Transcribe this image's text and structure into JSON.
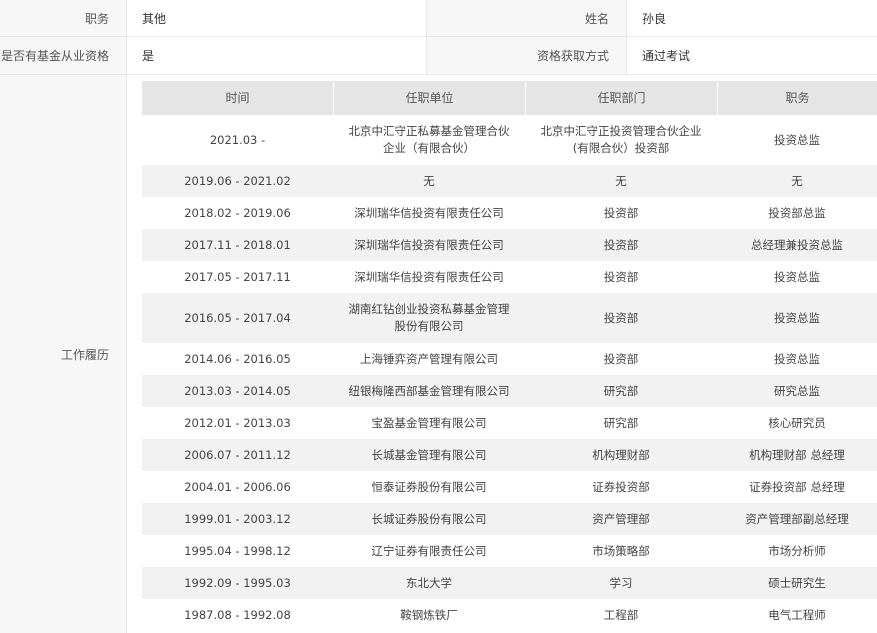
{
  "profile": {
    "position_label": "职务",
    "position_value": "其他",
    "name_label": "姓名",
    "name_value": "孙良",
    "qualification_label": "是否有基金从业资格",
    "qualification_value": "是",
    "method_label": "资格获取方式",
    "method_value": "通过考试",
    "history_label": "工作履历"
  },
  "work_history": {
    "headers": [
      "时间",
      "任职单位",
      "任职部门",
      "职务"
    ],
    "rows": [
      [
        "2021.03 -",
        "北京中汇守正私募基金管理合伙企业（有限合伙）",
        "北京中汇守正投资管理合伙企业(有限合伙）投资部",
        "投资总监"
      ],
      [
        "2019.06 - 2021.02",
        "无",
        "无",
        "无"
      ],
      [
        "2018.02 - 2019.06",
        "深圳瑞华信投资有限责任公司",
        "投资部",
        "投资部总监"
      ],
      [
        "2017.11 - 2018.01",
        "深圳瑞华信投资有限责任公司",
        "投资部",
        "总经理兼投资总监"
      ],
      [
        "2017.05 - 2017.11",
        "深圳瑞华信投资有限责任公司",
        "投资部",
        "投资总监"
      ],
      [
        "2016.05 - 2017.04",
        "湖南红钻创业投资私募基金管理股份有限公司",
        "投资部",
        "投资总监"
      ],
      [
        "2014.06 - 2016.05",
        "上海锤弈资产管理有限公司",
        "投资部",
        "投资总监"
      ],
      [
        "2013.03 - 2014.05",
        "纽银梅隆西部基金管理有限公司",
        "研究部",
        "研究总监"
      ],
      [
        "2012.01 - 2013.03",
        "宝盈基金管理有限公司",
        "研究部",
        "核心研究员"
      ],
      [
        "2006.07 - 2011.12",
        "长城基金管理有限公司",
        "机构理财部",
        "机构理财部 总经理"
      ],
      [
        "2004.01 - 2006.06",
        "恒泰证券股份有限公司",
        "证券投资部",
        "证券投资部 总经理"
      ],
      [
        "1999.01 - 2003.12",
        "长城证券股份有限公司",
        "资产管理部",
        "资产管理部副总经理"
      ],
      [
        "1995.04 - 1998.12",
        "辽宁证券有限责任公司",
        "市场策略部",
        "市场分析师"
      ],
      [
        "1992.09 - 1995.03",
        "东北大学",
        "学习",
        "硕士研究生"
      ],
      [
        "1987.08 - 1992.08",
        "鞍钢炼铁厂",
        "工程部",
        "电气工程师"
      ]
    ]
  }
}
